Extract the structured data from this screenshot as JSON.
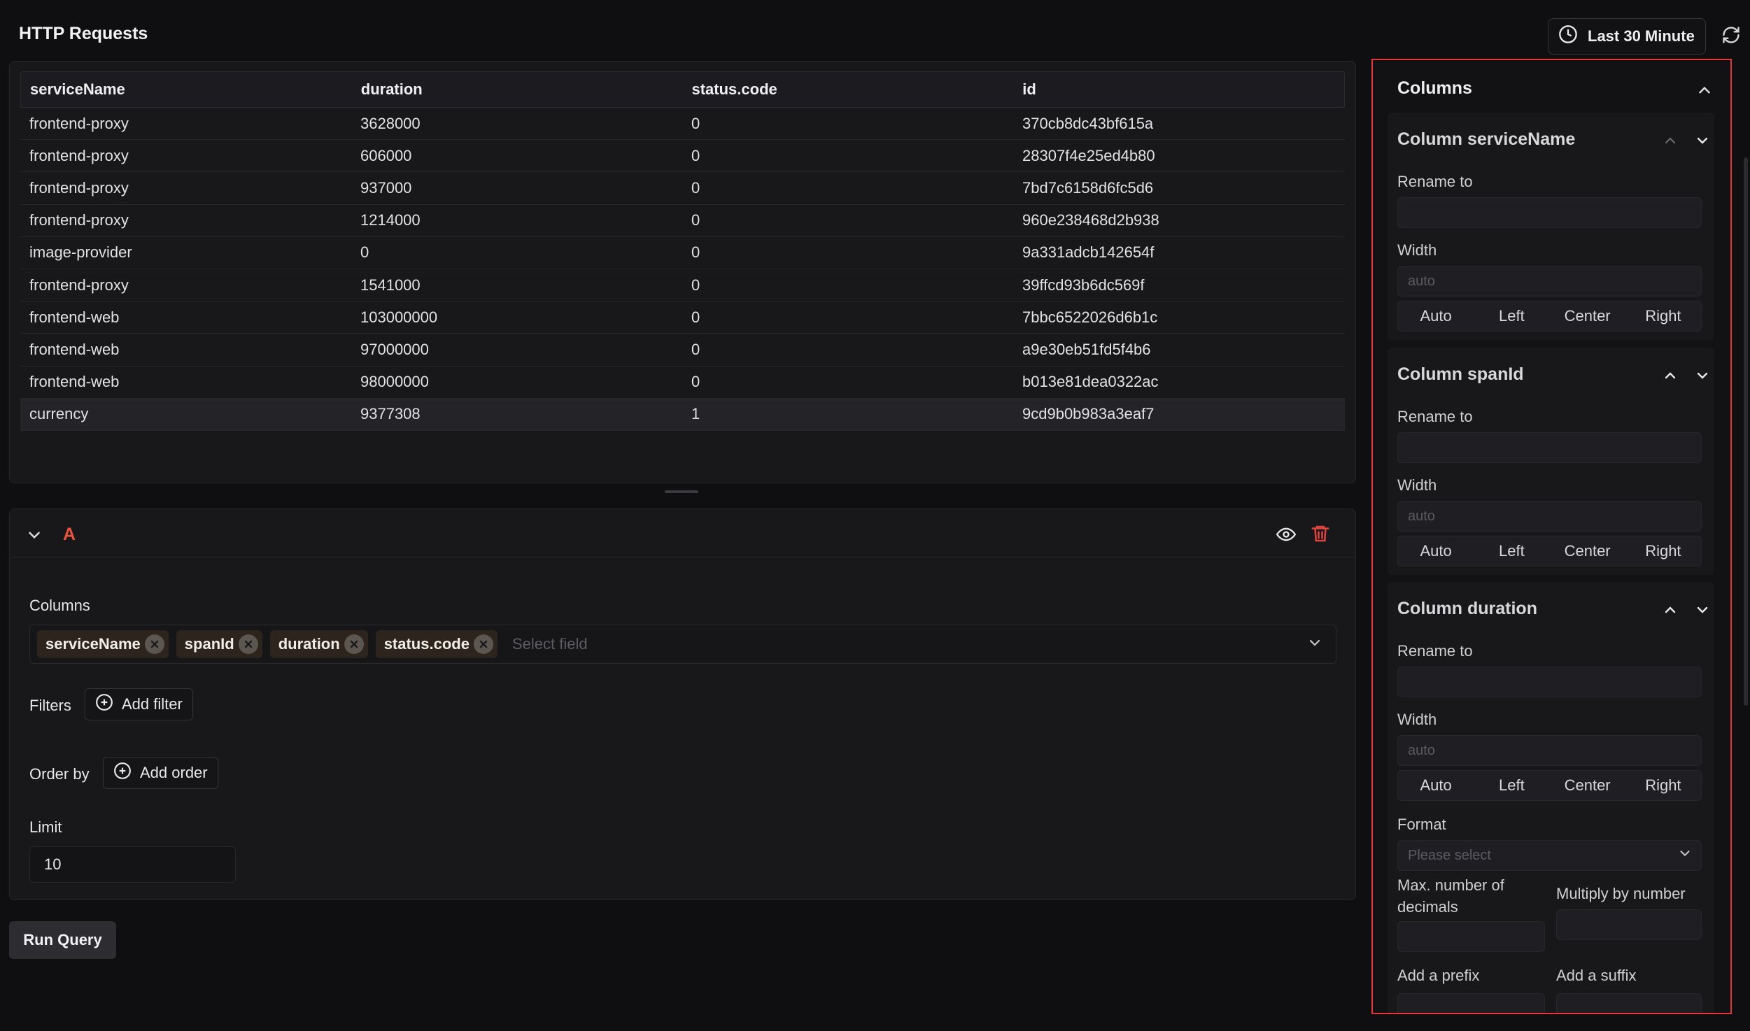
{
  "header": {
    "title": "HTTP Requests",
    "time_range": "Last 30 Minute",
    "clock_icon": "clock-icon",
    "refresh_icon": "refresh-icon"
  },
  "table": {
    "headers": [
      "serviceName",
      "duration",
      "status.code",
      "id"
    ],
    "rows": [
      [
        "frontend-proxy",
        "3628000",
        "0",
        "370cb8dc43bf615a"
      ],
      [
        "frontend-proxy",
        "606000",
        "0",
        "28307f4e25ed4b80"
      ],
      [
        "frontend-proxy",
        "937000",
        "0",
        "7bd7c6158d6fc5d6"
      ],
      [
        "frontend-proxy",
        "1214000",
        "0",
        "960e238468d2b938"
      ],
      [
        "image-provider",
        "0",
        "0",
        "9a331adcb142654f"
      ],
      [
        "frontend-proxy",
        "1541000",
        "0",
        "39ffcd93b6dc569f"
      ],
      [
        "frontend-web",
        "103000000",
        "0",
        "7bbc6522026d6b1c"
      ],
      [
        "frontend-web",
        "97000000",
        "0",
        "a9e30eb51fd5f4b6"
      ],
      [
        "frontend-web",
        "98000000",
        "0",
        "b013e81dea0322ac"
      ],
      [
        "currency",
        "9377308",
        "1",
        "9cd9b0b983a3eaf7"
      ]
    ]
  },
  "query": {
    "letter": "A",
    "columns_label": "Columns",
    "tags": [
      "serviceName",
      "spanId",
      "duration",
      "status.code"
    ],
    "select_placeholder": "Select field",
    "filters_label": "Filters",
    "add_filter": "Add filter",
    "order_label": "Order by",
    "add_order": "Add order",
    "limit_label": "Limit",
    "limit_value": "10",
    "run_label": "Run Query"
  },
  "side": {
    "title": "Columns",
    "cards": [
      {
        "title": "Column serviceName",
        "rename_label": "Rename to",
        "width_label": "Width",
        "width_placeholder": "auto",
        "align": [
          "Auto",
          "Left",
          "Center",
          "Right"
        ]
      },
      {
        "title": "Column spanId",
        "rename_label": "Rename to",
        "width_label": "Width",
        "width_placeholder": "auto",
        "align": [
          "Auto",
          "Left",
          "Center",
          "Right"
        ]
      },
      {
        "title": "Column duration",
        "rename_label": "Rename to",
        "width_label": "Width",
        "width_placeholder": "auto",
        "align": [
          "Auto",
          "Left",
          "Center",
          "Right"
        ],
        "format_label": "Format",
        "format_placeholder": "Please select",
        "decimals_label": "Max. number of decimals",
        "multiply_label": "Multiply by number",
        "prefix_label": "Add a prefix",
        "suffix_label": "Add a suffix"
      }
    ]
  },
  "colors": {
    "accent_red": "#e0393a",
    "query_letter": "#e8553f",
    "trash": "#e0443e"
  }
}
